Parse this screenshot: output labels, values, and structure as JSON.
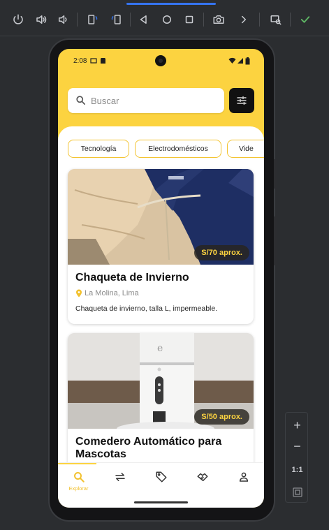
{
  "emulator_toolbar": {
    "buttons": [
      "power-icon",
      "volume-up-icon",
      "volume-down-icon",
      "rotate-left-icon",
      "rotate-right-icon",
      "back-icon",
      "home-icon",
      "overview-icon",
      "screenshot-icon",
      "more-icon",
      "device-mirror-icon",
      "check-icon"
    ]
  },
  "status_bar": {
    "time": "2:08"
  },
  "search": {
    "placeholder": "Buscar"
  },
  "categories": [
    "Tecnología",
    "Electrodomésticos",
    "Vide"
  ],
  "listings": [
    {
      "title": "Chaqueta de Invierno",
      "location": "La Molina, Lima",
      "description": "Chaqueta de invierno, talla L, impermeable.",
      "price": "S/70 aprox."
    },
    {
      "title": "Comedero Automático para Mascotas",
      "price": "S/50 aprox."
    }
  ],
  "bottom_nav": {
    "items": [
      {
        "icon": "search-icon",
        "label": "Explorar",
        "active": true
      },
      {
        "icon": "swap-icon",
        "label": ""
      },
      {
        "icon": "tag-icon",
        "label": ""
      },
      {
        "icon": "handshake-icon",
        "label": ""
      },
      {
        "icon": "person-icon",
        "label": ""
      }
    ]
  },
  "zoom_panel": {
    "plus": "+",
    "minus": "−",
    "ratio": "1:1"
  },
  "colors": {
    "brand_yellow": "#fcd340",
    "chip_border": "#f3c432",
    "price_text": "#fcd340",
    "toolbar_bg": "#2b2d30",
    "check_green": "#5fb865"
  }
}
